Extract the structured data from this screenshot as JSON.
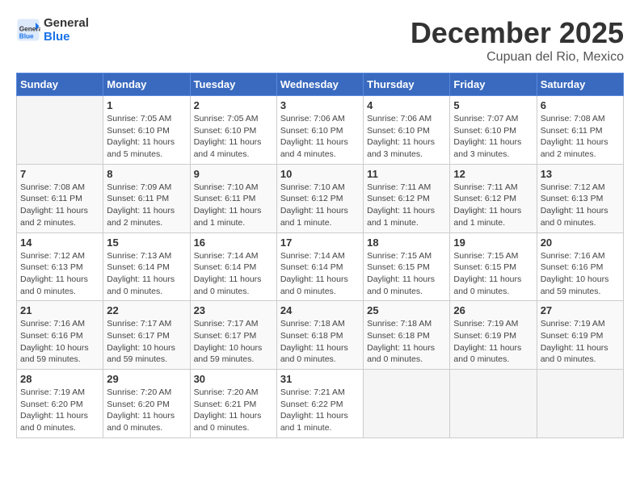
{
  "header": {
    "logo": {
      "line1": "General",
      "line2": "Blue"
    },
    "month": "December 2025",
    "location": "Cupuan del Rio, Mexico"
  },
  "days_of_week": [
    "Sunday",
    "Monday",
    "Tuesday",
    "Wednesday",
    "Thursday",
    "Friday",
    "Saturday"
  ],
  "weeks": [
    [
      {
        "day": "",
        "info": ""
      },
      {
        "day": "1",
        "info": "Sunrise: 7:05 AM\nSunset: 6:10 PM\nDaylight: 11 hours\nand 5 minutes."
      },
      {
        "day": "2",
        "info": "Sunrise: 7:05 AM\nSunset: 6:10 PM\nDaylight: 11 hours\nand 4 minutes."
      },
      {
        "day": "3",
        "info": "Sunrise: 7:06 AM\nSunset: 6:10 PM\nDaylight: 11 hours\nand 4 minutes."
      },
      {
        "day": "4",
        "info": "Sunrise: 7:06 AM\nSunset: 6:10 PM\nDaylight: 11 hours\nand 3 minutes."
      },
      {
        "day": "5",
        "info": "Sunrise: 7:07 AM\nSunset: 6:10 PM\nDaylight: 11 hours\nand 3 minutes."
      },
      {
        "day": "6",
        "info": "Sunrise: 7:08 AM\nSunset: 6:11 PM\nDaylight: 11 hours\nand 2 minutes."
      }
    ],
    [
      {
        "day": "7",
        "info": "Sunrise: 7:08 AM\nSunset: 6:11 PM\nDaylight: 11 hours\nand 2 minutes."
      },
      {
        "day": "8",
        "info": "Sunrise: 7:09 AM\nSunset: 6:11 PM\nDaylight: 11 hours\nand 2 minutes."
      },
      {
        "day": "9",
        "info": "Sunrise: 7:10 AM\nSunset: 6:11 PM\nDaylight: 11 hours\nand 1 minute."
      },
      {
        "day": "10",
        "info": "Sunrise: 7:10 AM\nSunset: 6:12 PM\nDaylight: 11 hours\nand 1 minute."
      },
      {
        "day": "11",
        "info": "Sunrise: 7:11 AM\nSunset: 6:12 PM\nDaylight: 11 hours\nand 1 minute."
      },
      {
        "day": "12",
        "info": "Sunrise: 7:11 AM\nSunset: 6:12 PM\nDaylight: 11 hours\nand 1 minute."
      },
      {
        "day": "13",
        "info": "Sunrise: 7:12 AM\nSunset: 6:13 PM\nDaylight: 11 hours\nand 0 minutes."
      }
    ],
    [
      {
        "day": "14",
        "info": "Sunrise: 7:12 AM\nSunset: 6:13 PM\nDaylight: 11 hours\nand 0 minutes."
      },
      {
        "day": "15",
        "info": "Sunrise: 7:13 AM\nSunset: 6:14 PM\nDaylight: 11 hours\nand 0 minutes."
      },
      {
        "day": "16",
        "info": "Sunrise: 7:14 AM\nSunset: 6:14 PM\nDaylight: 11 hours\nand 0 minutes."
      },
      {
        "day": "17",
        "info": "Sunrise: 7:14 AM\nSunset: 6:14 PM\nDaylight: 11 hours\nand 0 minutes."
      },
      {
        "day": "18",
        "info": "Sunrise: 7:15 AM\nSunset: 6:15 PM\nDaylight: 11 hours\nand 0 minutes."
      },
      {
        "day": "19",
        "info": "Sunrise: 7:15 AM\nSunset: 6:15 PM\nDaylight: 11 hours\nand 0 minutes."
      },
      {
        "day": "20",
        "info": "Sunrise: 7:16 AM\nSunset: 6:16 PM\nDaylight: 10 hours\nand 59 minutes."
      }
    ],
    [
      {
        "day": "21",
        "info": "Sunrise: 7:16 AM\nSunset: 6:16 PM\nDaylight: 10 hours\nand 59 minutes."
      },
      {
        "day": "22",
        "info": "Sunrise: 7:17 AM\nSunset: 6:17 PM\nDaylight: 10 hours\nand 59 minutes."
      },
      {
        "day": "23",
        "info": "Sunrise: 7:17 AM\nSunset: 6:17 PM\nDaylight: 10 hours\nand 59 minutes."
      },
      {
        "day": "24",
        "info": "Sunrise: 7:18 AM\nSunset: 6:18 PM\nDaylight: 11 hours\nand 0 minutes."
      },
      {
        "day": "25",
        "info": "Sunrise: 7:18 AM\nSunset: 6:18 PM\nDaylight: 11 hours\nand 0 minutes."
      },
      {
        "day": "26",
        "info": "Sunrise: 7:19 AM\nSunset: 6:19 PM\nDaylight: 11 hours\nand 0 minutes."
      },
      {
        "day": "27",
        "info": "Sunrise: 7:19 AM\nSunset: 6:19 PM\nDaylight: 11 hours\nand 0 minutes."
      }
    ],
    [
      {
        "day": "28",
        "info": "Sunrise: 7:19 AM\nSunset: 6:20 PM\nDaylight: 11 hours\nand 0 minutes."
      },
      {
        "day": "29",
        "info": "Sunrise: 7:20 AM\nSunset: 6:20 PM\nDaylight: 11 hours\nand 0 minutes."
      },
      {
        "day": "30",
        "info": "Sunrise: 7:20 AM\nSunset: 6:21 PM\nDaylight: 11 hours\nand 0 minutes."
      },
      {
        "day": "31",
        "info": "Sunrise: 7:21 AM\nSunset: 6:22 PM\nDaylight: 11 hours\nand 1 minute."
      },
      {
        "day": "",
        "info": ""
      },
      {
        "day": "",
        "info": ""
      },
      {
        "day": "",
        "info": ""
      }
    ]
  ]
}
